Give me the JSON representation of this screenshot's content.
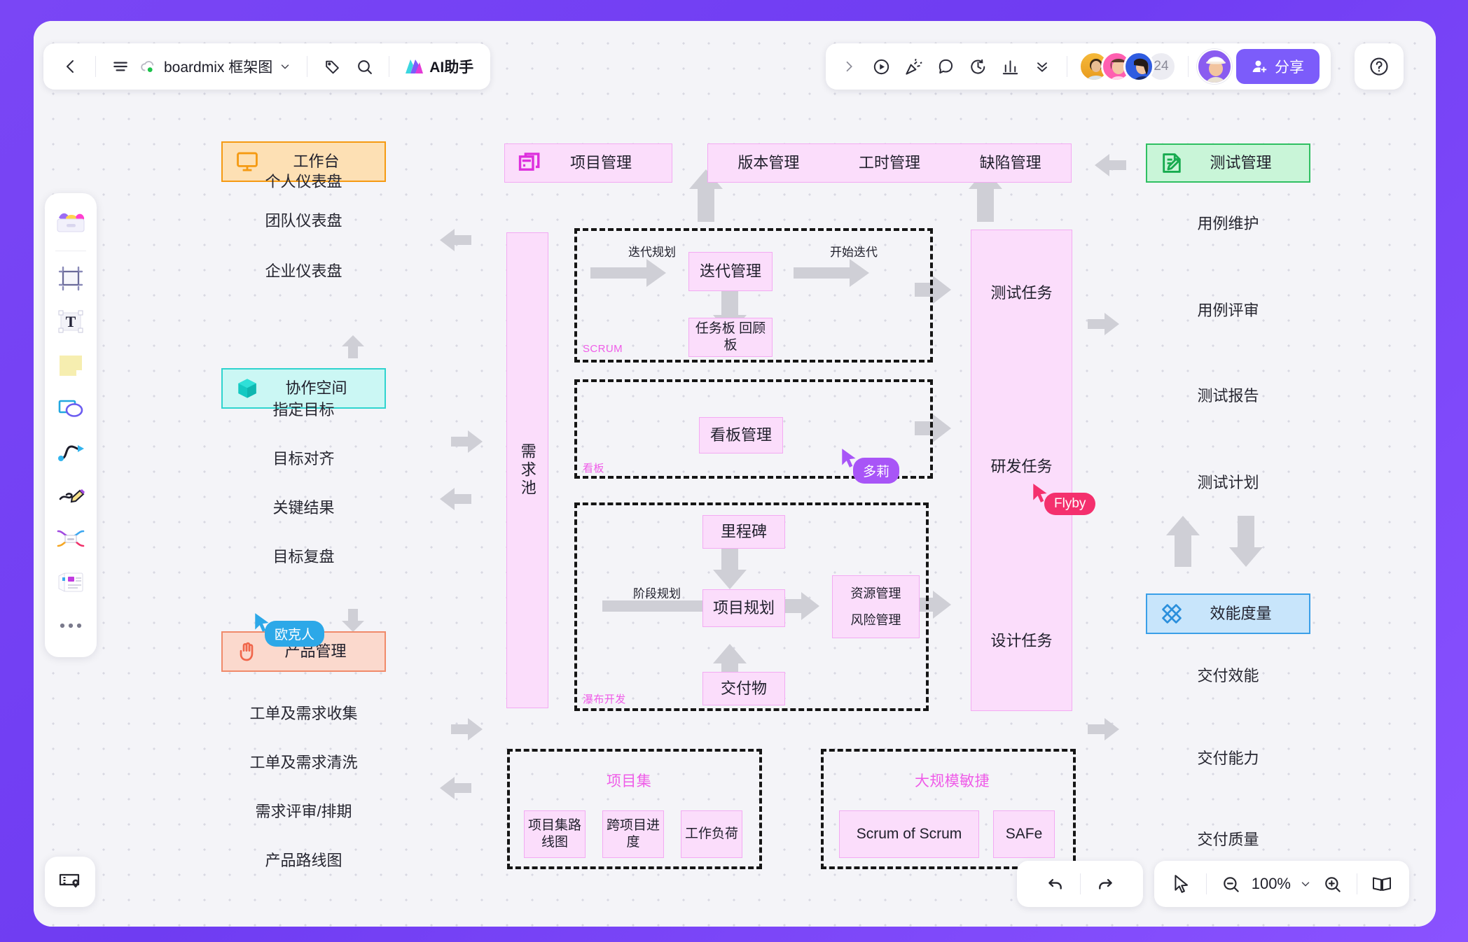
{
  "app": {
    "title": "boardmix 框架图",
    "ai_assistant": "AI助手",
    "share_label": "分享",
    "avatar_overflow": "24",
    "zoom_level": "100%"
  },
  "toolbar_left": {
    "back": "back-arrow",
    "menu": "hamburger-menu",
    "cloud": "cloud-saved",
    "chevron": "chevron-down",
    "tag": "tag-icon",
    "search": "search-icon",
    "ai_logo": "ai-logo"
  },
  "toolbar_right": {
    "expand": "chevron-right",
    "present": "present-icon",
    "celebrate": "celebrate-icon",
    "comment": "comment-icon",
    "timer": "timer-icon",
    "vote": "vote-chart-icon",
    "more": "double-chevron-down",
    "help": "help-icon"
  },
  "left_rail": [
    {
      "name": "templates-icon"
    },
    {
      "name": "frame-icon"
    },
    {
      "name": "text-icon"
    },
    {
      "name": "sticky-note-icon"
    },
    {
      "name": "shapes-icon"
    },
    {
      "name": "connector-icon"
    },
    {
      "name": "pen-icon"
    },
    {
      "name": "mindmap-icon"
    },
    {
      "name": "card-icon"
    },
    {
      "name": "more-icon"
    }
  ],
  "bottom_bar": {
    "undo": "undo-icon",
    "redo": "redo-icon",
    "select": "cursor-icon",
    "zoom_out": "zoom-out-icon",
    "zoom_in": "zoom-in-icon",
    "presentation": "book-icon",
    "minimap": "minimap-icon"
  },
  "diagram": {
    "col_left": {
      "header": {
        "label": "工作台",
        "icon": "monitor-icon",
        "bg": "#fde0b4",
        "border": "#f59a12"
      },
      "items_a": [
        "个人仪表盘",
        "团队仪表盘",
        "企业仪表盘"
      ],
      "header2": {
        "label": "协作空间",
        "icon": "cube-icon",
        "bg": "#cbf7f4",
        "border": "#2fd4cf"
      },
      "items_b": [
        "指定目标",
        "目标对齐",
        "关键结果",
        "目标复盘"
      ],
      "header3": {
        "label": "产品管理",
        "icon": "hand-icon",
        "bg": "#fbd9cd",
        "border": "#f08a6a"
      },
      "items_c": [
        "工单及需求收集",
        "工单及需求清洗",
        "需求评审/排期",
        "产品路线图"
      ]
    },
    "col_center": {
      "pm_header": {
        "label": "项目管理",
        "icon": "project-icon"
      },
      "mgmt_bar": [
        "版本管理",
        "工时管理",
        "缺陷管理"
      ],
      "pool": "需求池",
      "scrum": {
        "group": "SCRUM",
        "edge_in": "迭代规划",
        "edge_out": "开始迭代",
        "nodes": [
          "迭代管理",
          "任务板  回顾板"
        ]
      },
      "kanban": {
        "group": "看板",
        "nodes": [
          "看板管理"
        ]
      },
      "waterfall": {
        "group": "瀑布开发",
        "edge_in": "阶段规划",
        "nodes": [
          "里程碑",
          "项目规划",
          "交付物"
        ],
        "side": [
          "资源管理",
          "风险管理"
        ]
      },
      "tasks": [
        "测试任务",
        "研发任务",
        "设计任务"
      ],
      "program": {
        "group": "项目集",
        "nodes": [
          "项目集路线图",
          "跨项目进度",
          "工作负荷"
        ]
      },
      "scaled": {
        "group": "大规模敏捷",
        "nodes": [
          "Scrum of Scrum",
          "SAFe"
        ]
      }
    },
    "col_right": {
      "header": {
        "label": "测试管理",
        "icon": "test-edit-icon",
        "bg": "#c9f5d8",
        "border": "#2fbf62"
      },
      "items_a": [
        "用例维护",
        "用例评审",
        "测试报告",
        "测试计划"
      ],
      "header2": {
        "label": "效能度量",
        "icon": "ruler-icon",
        "bg": "#c8e5fb",
        "border": "#3a9fe8"
      },
      "items_b": [
        "交付效能",
        "交付能力",
        "交付质量"
      ]
    },
    "cursors": [
      {
        "name": "欧克人",
        "color": "#2ca8e8"
      },
      {
        "name": "多莉",
        "color": "#a855f7"
      },
      {
        "name": "Flyby",
        "color": "#f4306d"
      }
    ]
  }
}
